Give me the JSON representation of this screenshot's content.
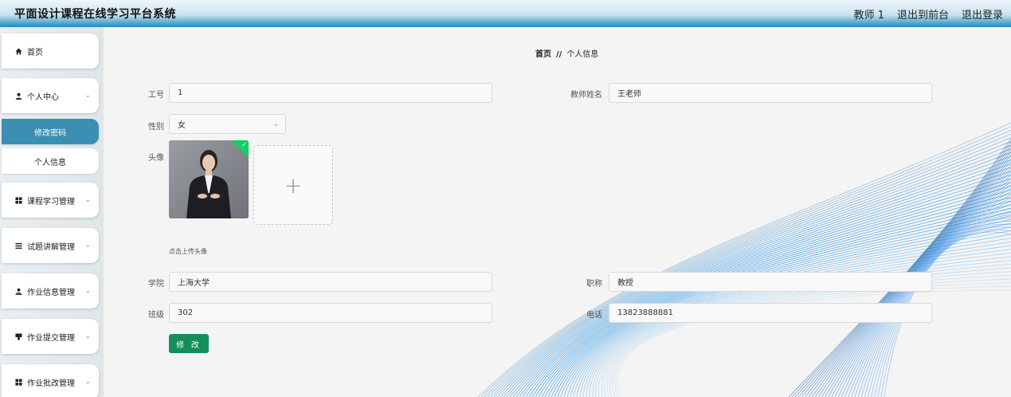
{
  "header": {
    "title": "平面设计课程在线学习平台系统",
    "user": "教师 1",
    "front_link": "退出到前台",
    "logout": "退出登录"
  },
  "sidebar": {
    "items": [
      {
        "label": "首页",
        "icon": "home-icon"
      },
      {
        "label": "个人中心",
        "icon": "user-icon"
      },
      {
        "label": "修改密码"
      },
      {
        "label": "个人信息"
      },
      {
        "label": "课程学习管理",
        "icon": "grid-icon"
      },
      {
        "label": "试题讲解管理",
        "icon": "list-icon"
      },
      {
        "label": "作业信息管理",
        "icon": "user-upload-icon"
      },
      {
        "label": "作业提交管理",
        "icon": "tag-icon"
      },
      {
        "label": "作业批改管理",
        "icon": "grid-icon"
      }
    ]
  },
  "breadcrumb": {
    "home": "首页",
    "separator": "//",
    "current": "个人信息"
  },
  "form": {
    "job_no": {
      "label": "工号",
      "value": "1"
    },
    "teacher_name": {
      "label": "教师姓名",
      "value": "王老师"
    },
    "gender": {
      "label": "性别",
      "value": "女"
    },
    "avatar": {
      "label": "头像",
      "upload_tip": "点击上传头像",
      "plus": "+"
    },
    "college": {
      "label": "学院",
      "value": "上海大学"
    },
    "title": {
      "label": "职称",
      "value": "教授"
    },
    "class": {
      "label": "班级",
      "value": "302"
    },
    "phone": {
      "label": "电话",
      "value": "13823888881"
    },
    "submit": "修 改"
  },
  "colors": {
    "accent": "#3b8fb3",
    "button": "#138f5e",
    "check": "#13ce66"
  }
}
